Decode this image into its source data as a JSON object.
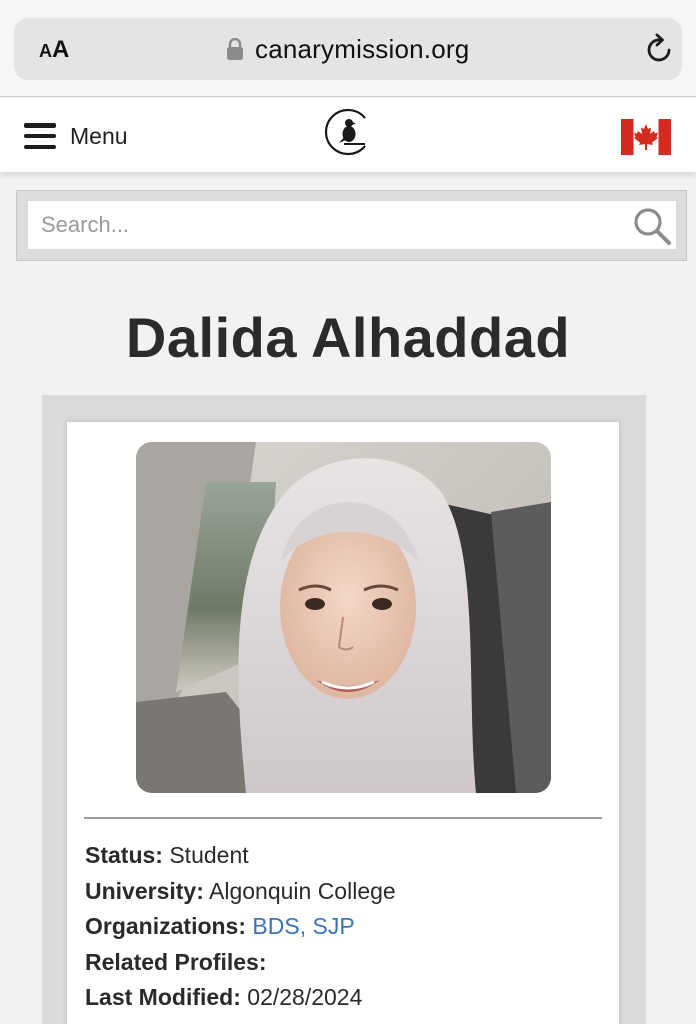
{
  "browser": {
    "text_size_small": "A",
    "text_size_large": "A",
    "url": "canarymission.org"
  },
  "header": {
    "menu_label": "Menu",
    "logo_icon": "canary-bird-logo",
    "flag_icon": "canada-flag-icon",
    "accent_color": "#d52b1e"
  },
  "search": {
    "placeholder": "Search..."
  },
  "profile": {
    "name": "Dalida Alhaddad",
    "fields": {
      "status_label": "Status:",
      "status_value": "Student",
      "university_label": "University:",
      "university_value": "Algonquin College",
      "organizations_label": "Organizations:",
      "organizations_value": "BDS, SJP",
      "related_label": "Related Profiles:",
      "modified_label": "Last Modified:",
      "modified_value": "02/28/2024"
    },
    "link_color": "#3a73b8"
  }
}
